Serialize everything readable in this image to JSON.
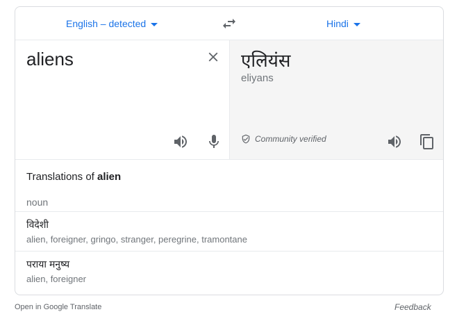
{
  "languages": {
    "source": "English – detected",
    "target": "Hindi"
  },
  "source": {
    "text": "aliens"
  },
  "target": {
    "text": "एलियंस",
    "transliteration": "eliyans",
    "verified_label": "Community verified"
  },
  "translations": {
    "heading_prefix": "Translations of ",
    "heading_word": "alien",
    "part_of_speech": "noun",
    "entries": [
      {
        "word": "विदेशी",
        "synonyms": "alien, foreigner, gringo, stranger, peregrine, tramontane"
      },
      {
        "word": "पराया मनुष्य",
        "synonyms": "alien, foreigner"
      }
    ]
  },
  "footer": {
    "open_link": "Open in Google Translate",
    "feedback": "Feedback"
  },
  "colors": {
    "accent": "#1a73e8",
    "icon": "#5f6368",
    "target_panel_bg": "#f5f5f5"
  }
}
